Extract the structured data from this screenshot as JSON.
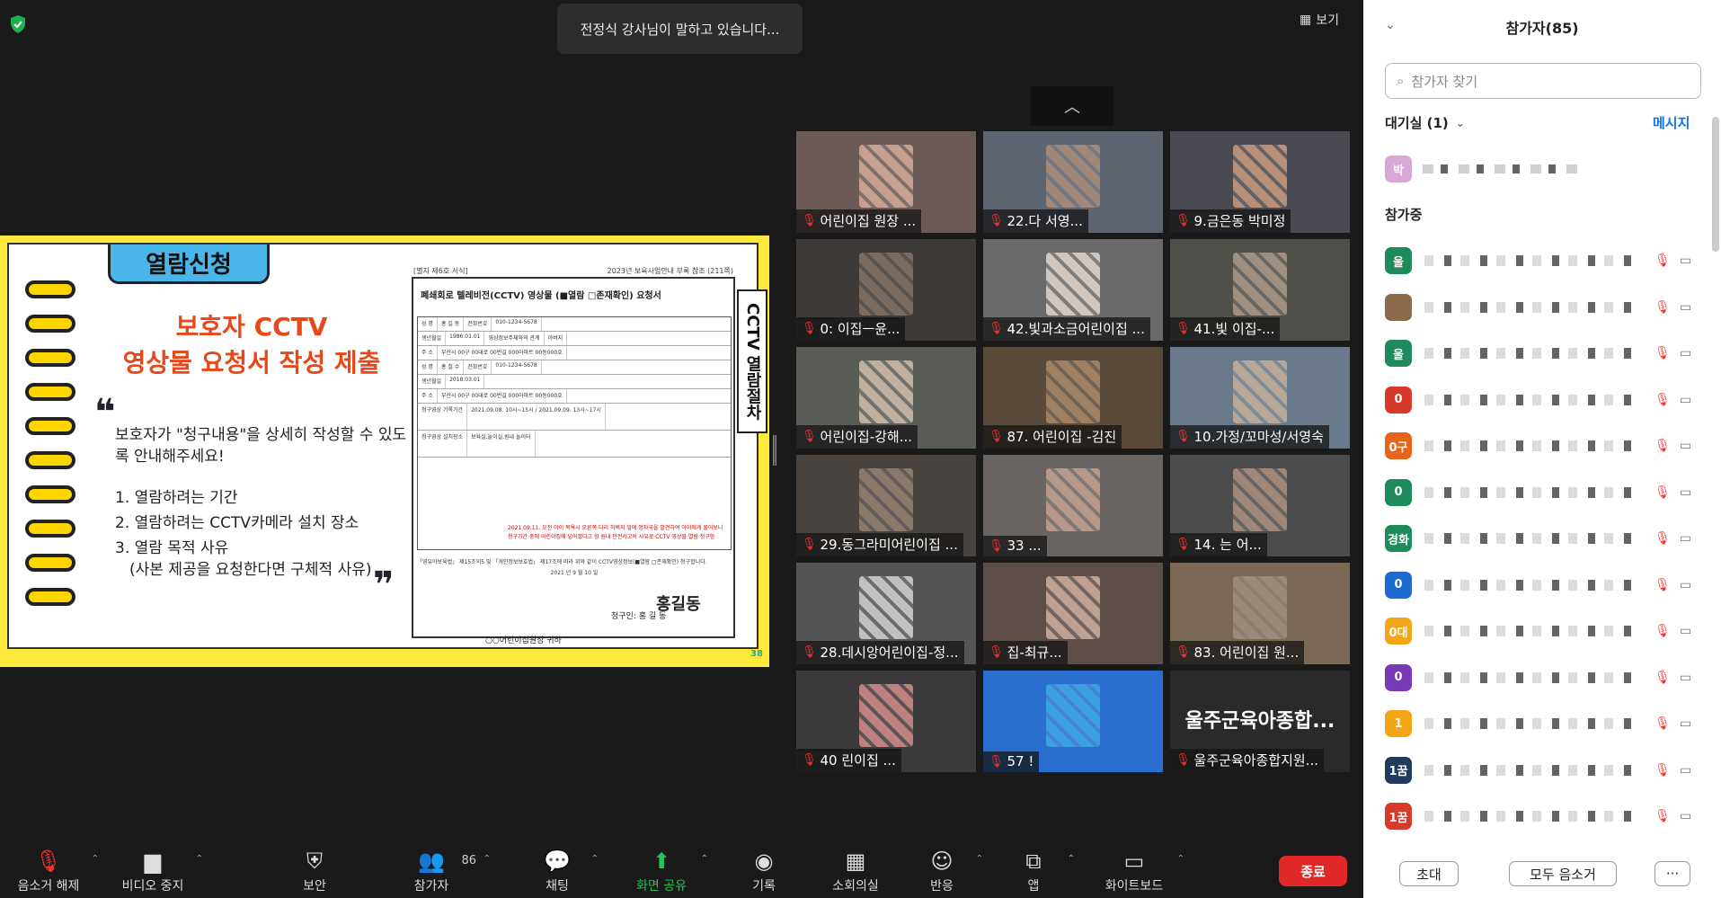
{
  "speaker_banner": "전정식 강사님이 말하고 있습니다...",
  "view_button": "보기",
  "slide": {
    "tab": "열람신청",
    "title_line1": "보호자 CCTV",
    "title_line2": "영상물 요청서 작성 제출",
    "quote_open": "❝",
    "quote_close": "❞",
    "intro": "보호자가 \"청구내용\"을 상세히 작성할 수 있도록 안내해주세요!",
    "items": [
      "1. 열람하려는 기간",
      "2. 열람하려는 CCTV카메라 설치 장소",
      "3. 열람 목적 사유",
      "(사본 제공을 요청한다면 구체적 사유)"
    ],
    "vertical_label": "CCTV 열람절차",
    "page_number": "38",
    "form": {
      "top_left": "[별지 제6호 서식]",
      "top_right": "2023년 보육사업안내 부록 참조 (211쪽)",
      "title": "폐쇄회로 텔레비전(CCTV) 영상물 (■열람 □존재확인) 요청서",
      "rows": [
        [
          "성 명",
          "홍 길 동",
          "전화번호",
          "010-1234-5678"
        ],
        [
          "생년월일",
          "1986.01.01",
          "영상정보주체와의 관계",
          "아버지"
        ],
        [
          "주 소",
          "부산시 00구 00대로 00번길 000아파트 00동000호",
          "",
          ""
        ],
        [
          "성 명",
          "홍 철 수",
          "전화번호",
          "010-1234-5678"
        ],
        [
          "생년월일",
          "2018.03.01",
          "",
          ""
        ],
        [
          "주 소",
          "부산시 00구 00대로 00번길 000아파트 00동000호",
          "",
          ""
        ],
        [
          "청구영상 기록기간",
          "2021.09.08. 10시~15시 / 2021.09.09. 13시~17시",
          "",
          ""
        ],
        [
          "청구영상 설치장소",
          "보육실,놀이실,원내 놀이터",
          "",
          ""
        ]
      ],
      "red_text": "2021.09.11. 오전 아이 목욕시 오른쪽 다리 허벅지 앞에 멍자국을 발견하여 아이에게 물어보니 청구기간 중에 어린이집에 넘어졌다고 함 원내 안전사고의 사유로 CCTV 영상물 열람 청구함",
      "footer": "「영유아보육법」 제15조의5 및 「개인정보보호법」 제17조에 따라 위와 같이 CCTV영상정보(■열람 □존재확인) 청구합니다.",
      "date": "2021 년 9 월 10 일",
      "signer": "청구인: 홍 길 동",
      "stamp": "홍길동",
      "addressee": "○○어린이집원장 귀하"
    }
  },
  "tiles": [
    {
      "label": "어린이집 원장 ..."
    },
    {
      "label": "22.다    서영..."
    },
    {
      "label": "9.금은동 박미정"
    },
    {
      "label": "0:    이집ㅡ윤..."
    },
    {
      "label": "42.빛과소금어린이집 ..."
    },
    {
      "label": "41.빛   이집-..."
    },
    {
      "label": "어린이집-강해..."
    },
    {
      "label": "87.   어린이집 -김진"
    },
    {
      "label": "10.가정/꼬마성/서영숙"
    },
    {
      "label": "29.동그라미어린이집 ..."
    },
    {
      "label": "33   ..."
    },
    {
      "label": "14.    는 어..."
    },
    {
      "label": "28.데시앙어린이집-정..."
    },
    {
      "label": "    집-최규..."
    },
    {
      "label": "83.   어린이집 원..."
    },
    {
      "label": "40    린이집 ..."
    },
    {
      "label": "57    !"
    },
    {
      "label": "울주군육아종합지원..."
    }
  ],
  "tile_big_name": "울주군육아종합...",
  "panel": {
    "title": "참가자(85)",
    "search_placeholder": "참가자 찾기",
    "waiting": "대기실 (1)",
    "message": "메시지",
    "waiting_avatar": "박",
    "members": "참가중",
    "avatars": [
      {
        "text": "울",
        "color": "#1f8a5b"
      },
      {
        "text": "",
        "color": "#8a6a4a"
      },
      {
        "text": "울",
        "color": "#1f8a5b"
      },
      {
        "text": "0",
        "color": "#d73a2a"
      },
      {
        "text": "0구",
        "color": "#e8641b"
      },
      {
        "text": "0",
        "color": "#1f8a5b"
      },
      {
        "text": "경화",
        "color": "#1f8a5b"
      },
      {
        "text": "0",
        "color": "#1f6ad0"
      },
      {
        "text": "0대",
        "color": "#f2a516"
      },
      {
        "text": "0",
        "color": "#7a3ab8"
      },
      {
        "text": "1",
        "color": "#f2a516"
      },
      {
        "text": "1꿈",
        "color": "#223a5c"
      },
      {
        "text": "1꿈",
        "color": "#d73a2a"
      }
    ],
    "invite": "초대",
    "mute_all": "모두 음소거",
    "more": "···"
  },
  "toolbar": {
    "unmute": "음소거 해제",
    "stop_video": "비디오 중지",
    "security": "보안",
    "participants": "참가자",
    "participant_count": "86",
    "chat": "채팅",
    "share": "화면 공유",
    "record": "기록",
    "breakout": "소회의실",
    "reactions": "반응",
    "apps": "앱",
    "whiteboard": "화이트보드",
    "end": "종료"
  }
}
